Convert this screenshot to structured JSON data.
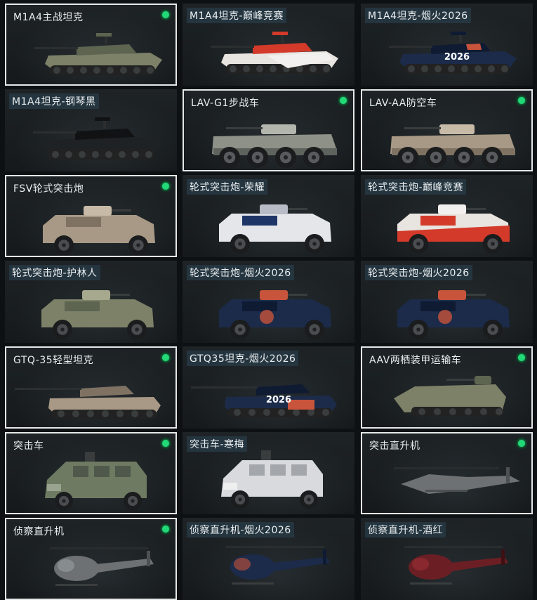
{
  "colors": {
    "owned_dot": "#22d977",
    "owned_border": "#e6e8e8",
    "background": "#0d1113"
  },
  "vehicles": [
    {
      "name": "M1A4主战坦克",
      "owned": true,
      "type": "tank",
      "skin": "camo-green",
      "icon": "tank-icon"
    },
    {
      "name": "M1A4坦克-巅峰竞赛",
      "owned": false,
      "type": "tank",
      "skin": "red-white",
      "icon": "tank-icon"
    },
    {
      "name": "M1A4坦克-烟火2026",
      "owned": false,
      "type": "tank",
      "skin": "firework",
      "icon": "tank-icon",
      "badge": "2026"
    },
    {
      "name": "M1A4坦克-钢琴黑",
      "owned": false,
      "type": "tank",
      "skin": "black",
      "icon": "tank-icon"
    },
    {
      "name": "LAV-G1步战车",
      "owned": true,
      "type": "apc",
      "skin": "camo-grey",
      "icon": "armored-vehicle-icon"
    },
    {
      "name": "LAV-AA防空车",
      "owned": true,
      "type": "apc",
      "skin": "desert",
      "icon": "armored-vehicle-icon"
    },
    {
      "name": "FSV轮式突击炮",
      "owned": true,
      "type": "wheeled",
      "skin": "desert",
      "icon": "armored-car-icon"
    },
    {
      "name": "轮式突击炮-荣耀",
      "owned": false,
      "type": "wheeled",
      "skin": "blue-white",
      "icon": "armored-car-icon"
    },
    {
      "name": "轮式突击炮-巅峰竞赛",
      "owned": false,
      "type": "wheeled",
      "skin": "red-white",
      "icon": "armored-car-icon"
    },
    {
      "name": "轮式突击炮-护林人",
      "owned": false,
      "type": "wheeled",
      "skin": "camo-green",
      "icon": "armored-car-icon"
    },
    {
      "name": "轮式突击炮-烟火2026",
      "owned": false,
      "type": "wheeled",
      "skin": "firework",
      "icon": "armored-car-icon"
    },
    {
      "name": "轮式突击炮-烟火2026",
      "owned": false,
      "type": "wheeled",
      "skin": "firework",
      "icon": "armored-car-icon"
    },
    {
      "name": "GTQ-35轻型坦克",
      "owned": true,
      "type": "lighttank",
      "skin": "desert",
      "icon": "light-tank-icon"
    },
    {
      "name": "GTQ35坦克-烟火2026",
      "owned": false,
      "type": "lighttank",
      "skin": "firework",
      "icon": "light-tank-icon",
      "badge": "2026"
    },
    {
      "name": "AAV两栖装甲运输车",
      "owned": true,
      "type": "amphibious",
      "skin": "camo-green",
      "icon": "amphibious-vehicle-icon"
    },
    {
      "name": "突击车",
      "owned": true,
      "type": "mrap",
      "skin": "olive",
      "icon": "assault-vehicle-icon"
    },
    {
      "name": "突击车-寒梅",
      "owned": false,
      "type": "mrap",
      "skin": "white",
      "icon": "assault-vehicle-icon"
    },
    {
      "name": "突击直升机",
      "owned": true,
      "type": "attackheli",
      "skin": "grey",
      "icon": "attack-helicopter-icon"
    },
    {
      "name": "侦察直升机",
      "owned": true,
      "type": "scoutheli",
      "skin": "grey",
      "icon": "scout-helicopter-icon"
    },
    {
      "name": "侦察直升机-烟火2026",
      "owned": false,
      "type": "scoutheli",
      "skin": "firework",
      "icon": "scout-helicopter-icon"
    },
    {
      "name": "侦察直升机-酒红",
      "owned": false,
      "type": "scoutheli",
      "skin": "wine-red",
      "icon": "scout-helicopter-icon"
    }
  ]
}
